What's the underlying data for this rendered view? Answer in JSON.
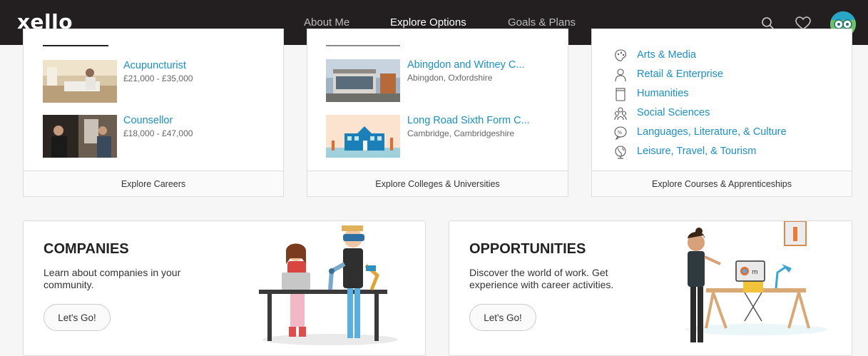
{
  "header": {
    "logo": "xello",
    "nav": [
      "About Me",
      "Explore Options",
      "Goals & Plans"
    ],
    "active_index": 1,
    "icons": [
      "search-icon",
      "heart-icon",
      "avatar"
    ]
  },
  "careers": {
    "items": [
      {
        "title": "Acupuncturist",
        "salary": "£21,000 - £35,000"
      },
      {
        "title": "Counsellor",
        "salary": "£18,000 - £47,000"
      }
    ],
    "footer": "Explore Careers"
  },
  "colleges": {
    "items": [
      {
        "title": "Abingdon and Witney C...",
        "location": "Abingdon, Oxfordshire"
      },
      {
        "title": "Long Road Sixth Form C...",
        "location": "Cambridge, Cambridgeshire"
      }
    ],
    "footer": "Explore Colleges & Universities"
  },
  "courses": {
    "categories": [
      {
        "label": "Arts & Media",
        "icon": "palette-icon"
      },
      {
        "label": "Retail & Enterprise",
        "icon": "person-icon"
      },
      {
        "label": "Humanities",
        "icon": "jar-icon"
      },
      {
        "label": "Social Sciences",
        "icon": "people-icon"
      },
      {
        "label": "Languages, Literature, & Culture",
        "icon": "speech-icon"
      },
      {
        "label": "Leisure, Travel, & Tourism",
        "icon": "globe-icon"
      }
    ],
    "footer": "Explore Courses & Apprenticeships"
  },
  "companies": {
    "title": "COMPANIES",
    "description": "Learn about companies in your community.",
    "button": "Let's Go!"
  },
  "opportunities": {
    "title": "OPPORTUNITIES",
    "description": "Discover the world of work. Get experience with career activities.",
    "button": "Let's Go!"
  }
}
